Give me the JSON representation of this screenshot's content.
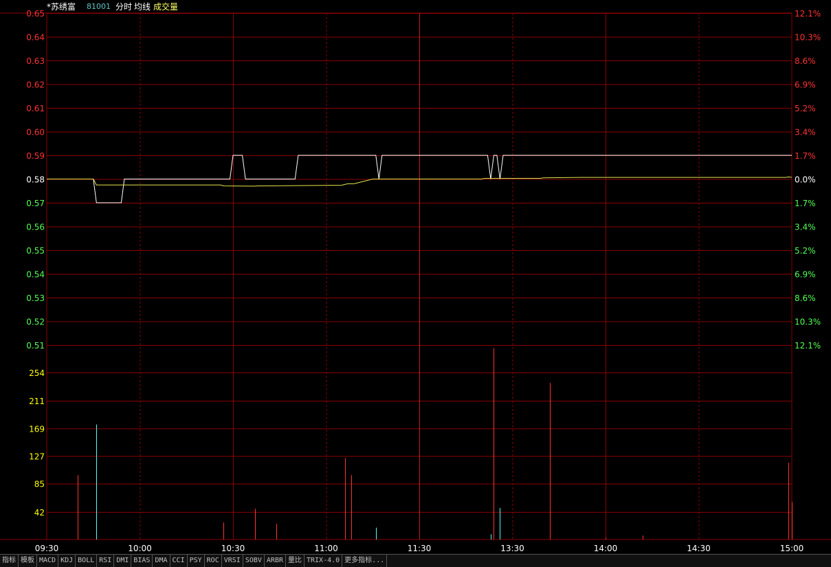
{
  "header": {
    "stock_name": "*苏绣富",
    "stock_code": "81001",
    "mode_label": "分时",
    "avg_label": "均线",
    "vol_label": "成交量"
  },
  "colors": {
    "background": "#000000",
    "grid": "#8b0000",
    "price_line": "#ffffff",
    "avg_line": "#e6e64b",
    "up": "#ff3232",
    "down": "#54ff54",
    "volume_label": "#ffff00",
    "volume_up": "#ff3232",
    "volume_down": "#54ffff"
  },
  "chart_data": {
    "type": "line",
    "base_price": 0.58,
    "price_axis": {
      "ticks": [
        0.65,
        0.64,
        0.63,
        0.62,
        0.61,
        0.6,
        0.59,
        0.58,
        0.57,
        0.56,
        0.55,
        0.54,
        0.53,
        0.52,
        0.51
      ],
      "labels": [
        "0.65",
        "0.64",
        "0.63",
        "0.62",
        "0.61",
        "0.60",
        "0.59",
        "0.58",
        "0.57",
        "0.56",
        "0.55",
        "0.54",
        "0.53",
        "0.52",
        "0.51"
      ],
      "ylim": [
        0.51,
        0.65
      ]
    },
    "pct_axis": {
      "labels": [
        "12.1%",
        "10.3%",
        "8.6%",
        "6.9%",
        "5.2%",
        "3.4%",
        "1.7%",
        "0.0%",
        "1.7%",
        "3.4%",
        "5.2%",
        "6.9%",
        "8.6%",
        "10.3%",
        "12.1%"
      ]
    },
    "volume_axis": {
      "labels": [
        "254",
        "211",
        "169",
        "127",
        "85",
        "42"
      ],
      "ticks": [
        254,
        211,
        169,
        127,
        85,
        42
      ],
      "ylim": [
        0,
        254
      ]
    },
    "time_axis": {
      "labels": [
        "09:30",
        "10:00",
        "10:30",
        "11:00",
        "11:30",
        "13:30",
        "14:00",
        "14:30",
        "15:00"
      ],
      "minutes": [
        0,
        30,
        60,
        90,
        120,
        150,
        180,
        210,
        240
      ]
    },
    "series": [
      {
        "key": "price",
        "points": [
          [
            0,
            0.58
          ],
          [
            15,
            0.58
          ],
          [
            16,
            0.57
          ],
          [
            24,
            0.57
          ],
          [
            25,
            0.58
          ],
          [
            59,
            0.58
          ],
          [
            60,
            0.59
          ],
          [
            63,
            0.59
          ],
          [
            64,
            0.58
          ],
          [
            80,
            0.58
          ],
          [
            81,
            0.59
          ],
          [
            106,
            0.59
          ],
          [
            107,
            0.58
          ],
          [
            108,
            0.59
          ],
          [
            142,
            0.59
          ],
          [
            143,
            0.58
          ],
          [
            144,
            0.59
          ],
          [
            145,
            0.59
          ],
          [
            146,
            0.58
          ],
          [
            147,
            0.59
          ],
          [
            240,
            0.59
          ]
        ]
      },
      {
        "key": "average",
        "points": [
          [
            0,
            0.58
          ],
          [
            15,
            0.58
          ],
          [
            16,
            0.5775
          ],
          [
            56,
            0.5775
          ],
          [
            57,
            0.5771
          ],
          [
            67,
            0.577
          ],
          [
            68,
            0.5771
          ],
          [
            95,
            0.5774
          ],
          [
            96,
            0.5777
          ],
          [
            97,
            0.578
          ],
          [
            99,
            0.578
          ],
          [
            105,
            0.58
          ],
          [
            140,
            0.58
          ],
          [
            141,
            0.5803
          ],
          [
            159,
            0.5803
          ],
          [
            160,
            0.5805
          ],
          [
            172,
            0.5807
          ],
          [
            238,
            0.5807
          ],
          [
            239,
            0.5809
          ],
          [
            240,
            0.5807
          ]
        ]
      }
    ],
    "volume": [
      {
        "t": 10,
        "v": 98,
        "dir": "up"
      },
      {
        "t": 16,
        "v": 175,
        "dir": "down"
      },
      {
        "t": 57,
        "v": 26,
        "dir": "up"
      },
      {
        "t": 67,
        "v": 47,
        "dir": "up"
      },
      {
        "t": 74,
        "v": 24,
        "dir": "up"
      },
      {
        "t": 96,
        "v": 124,
        "dir": "up"
      },
      {
        "t": 98,
        "v": 98,
        "dir": "up"
      },
      {
        "t": 106,
        "v": 18,
        "dir": "down"
      },
      {
        "t": 143,
        "v": 8,
        "dir": "down"
      },
      {
        "t": 144,
        "v": 291,
        "dir": "up"
      },
      {
        "t": 146,
        "v": 48,
        "dir": "down"
      },
      {
        "t": 162,
        "v": 238,
        "dir": "up"
      },
      {
        "t": 180,
        "v": 3,
        "dir": "up"
      },
      {
        "t": 192,
        "v": 6,
        "dir": "up"
      },
      {
        "t": 239,
        "v": 117,
        "dir": "up"
      },
      {
        "t": 240,
        "v": 57,
        "dir": "up"
      }
    ]
  },
  "tabs": [
    "指标",
    "模板",
    "MACD",
    "KDJ",
    "BOLL",
    "RSI",
    "DMI",
    "BIAS",
    "DMA",
    "CCI",
    "PSY",
    "ROC",
    "VRSI",
    "SOBV",
    "ARBR",
    "量比",
    "TRIX-4.0",
    "更多指标..."
  ]
}
